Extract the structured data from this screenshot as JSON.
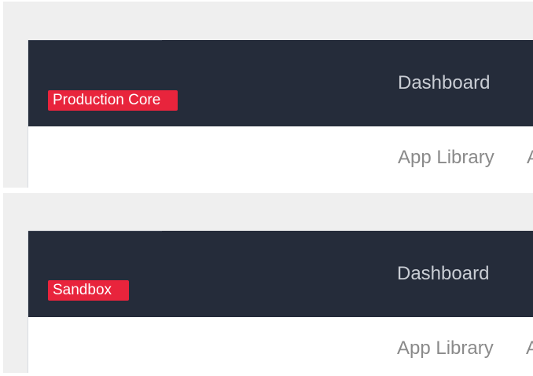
{
  "panels": [
    {
      "environment_badge": "Production Core",
      "nav": {
        "dashboard_label": "Dashboard"
      },
      "subnav": {
        "app_library_label": "App Library",
        "clipped_label": "A"
      }
    },
    {
      "environment_badge": "Sandbox",
      "nav": {
        "dashboard_label": "Dashboard"
      },
      "subnav": {
        "app_library_label": "App Library",
        "clipped_label": "A"
      }
    }
  ],
  "colors": {
    "navbar_bg": "#252c3a",
    "badge_bg": "#e8243c",
    "nav_text": "#c9cdd4",
    "subnav_text": "#8a8a8a",
    "frame_bg": "#efefef"
  }
}
